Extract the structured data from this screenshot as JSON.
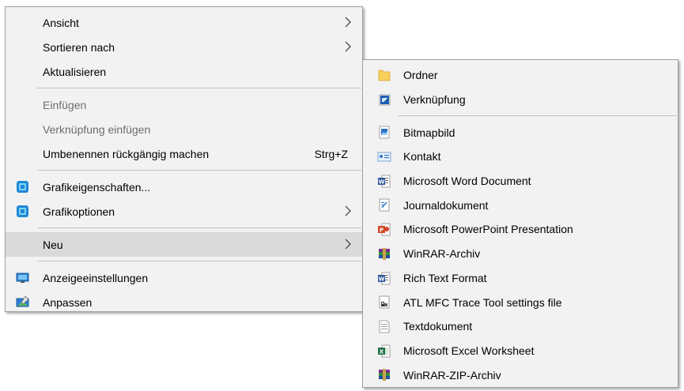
{
  "main_menu": {
    "ansicht": "Ansicht",
    "sortieren": "Sortieren nach",
    "aktualisieren": "Aktualisieren",
    "einfuegen": "Einfügen",
    "verknuepfung_einfuegen": "Verknüpfung einfügen",
    "umbenennen": "Umbenennen rückgängig machen",
    "umbenennen_shortcut": "Strg+Z",
    "grafikeigenschaften": "Grafikeigenschaften...",
    "grafikoptionen": "Grafikoptionen",
    "neu": "Neu",
    "anzeigeeinstellungen": "Anzeigeeinstellungen",
    "anpassen": "Anpassen"
  },
  "new_submenu": {
    "ordner": "Ordner",
    "verknuepfung": "Verknüpfung",
    "bitmap": "Bitmapbild",
    "kontakt": "Kontakt",
    "word": "Microsoft Word Document",
    "journal": "Journaldokument",
    "powerpoint": "Microsoft PowerPoint Presentation",
    "winrar": "WinRAR-Archiv",
    "rtf": "Rich Text Format",
    "atl": "ATL MFC Trace Tool settings file",
    "text": "Textdokument",
    "excel": "Microsoft Excel Worksheet",
    "winrar_zip": "WinRAR-ZIP-Archiv"
  },
  "colors": {
    "menu_bg": "#f2f2f2",
    "hover_bg": "#dadada",
    "disabled_text": "#6d6d6d",
    "separator": "#c4c4c4"
  },
  "icons": [
    "chevron-right-icon",
    "intel-graphics-icon",
    "display-settings-icon",
    "personalize-icon",
    "folder-icon",
    "shortcut-icon",
    "bitmap-icon",
    "contact-icon",
    "word-icon",
    "journal-icon",
    "powerpoint-icon",
    "winrar-icon",
    "rtf-icon",
    "atl-icon",
    "text-document-icon",
    "excel-icon",
    "winrar-zip-icon"
  ]
}
